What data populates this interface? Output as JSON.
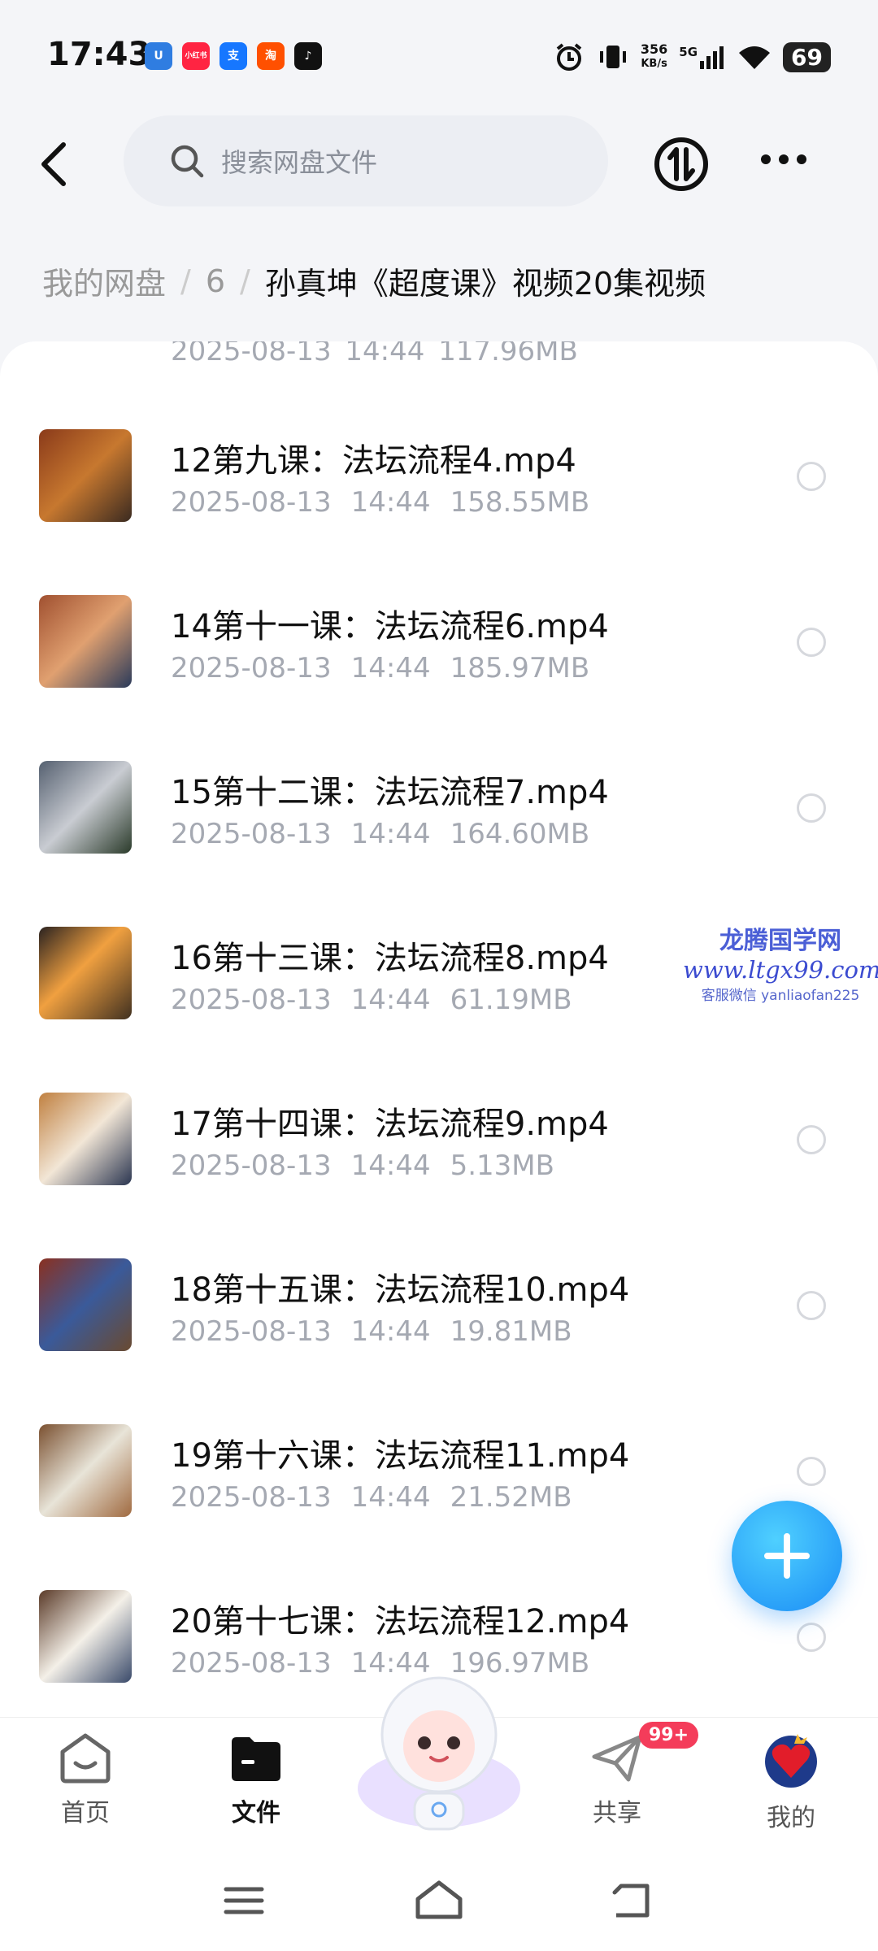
{
  "status_bar": {
    "time": "17:43",
    "app_icons": [
      {
        "name": "u-app-icon",
        "label": "U",
        "color": "#2f7de1"
      },
      {
        "name": "xiaohongshu-icon",
        "label": "小红书",
        "color": "#ff2442"
      },
      {
        "name": "alipay-icon",
        "label": "支",
        "color": "#1677ff"
      },
      {
        "name": "taobao-icon",
        "label": "淘",
        "color": "#ff5000"
      },
      {
        "name": "tiktok-icon",
        "label": "♪",
        "color": "#111111"
      }
    ],
    "net_speed": "356",
    "net_unit": "KB/s",
    "network": "5G",
    "battery": "69"
  },
  "header": {
    "search_placeholder": "搜索网盘文件"
  },
  "breadcrumb": {
    "root": "我的网盘",
    "sep": "/",
    "level": "6",
    "current": "孙真坤《超度课》视频20集视频"
  },
  "files_partial": {
    "meta": "2025-08-13 14:44 117.96MB"
  },
  "files": [
    {
      "name": "12第九课：法坛流程4.mp4",
      "date": "2025-08-13",
      "time": "14:44",
      "size": "158.55MB"
    },
    {
      "name": "14第十一课：法坛流程6.mp4",
      "date": "2025-08-13",
      "time": "14:44",
      "size": "185.97MB"
    },
    {
      "name": "15第十二课：法坛流程7.mp4",
      "date": "2025-08-13",
      "time": "14:44",
      "size": "164.60MB"
    },
    {
      "name": "16第十三课：法坛流程8.mp4",
      "date": "2025-08-13",
      "time": "14:44",
      "size": "61.19MB"
    },
    {
      "name": "17第十四课：法坛流程9.mp4",
      "date": "2025-08-13",
      "time": "14:44",
      "size": "5.13MB"
    },
    {
      "name": "18第十五课：法坛流程10.mp4",
      "date": "2025-08-13",
      "time": "14:44",
      "size": "19.81MB"
    },
    {
      "name": "19第十六课：法坛流程11.mp4",
      "date": "2025-08-13",
      "time": "14:44",
      "size": "21.52MB"
    },
    {
      "name": "20第十七课：法坛流程12.mp4",
      "date": "2025-08-13",
      "time": "14:44",
      "size": "196.97MB"
    }
  ],
  "watermark": {
    "line1": "龙腾国学网",
    "line2": "www.ltgx99.com",
    "line3": "客服微信 yanliaofan225"
  },
  "tabbar": {
    "home": "首页",
    "files": "文件",
    "share": "共享",
    "share_badge": "99+",
    "mine": "我的"
  },
  "colors": {
    "accent": "#1a8cf5",
    "badge": "#f43c5a",
    "meta_text": "#a5a9b2"
  }
}
